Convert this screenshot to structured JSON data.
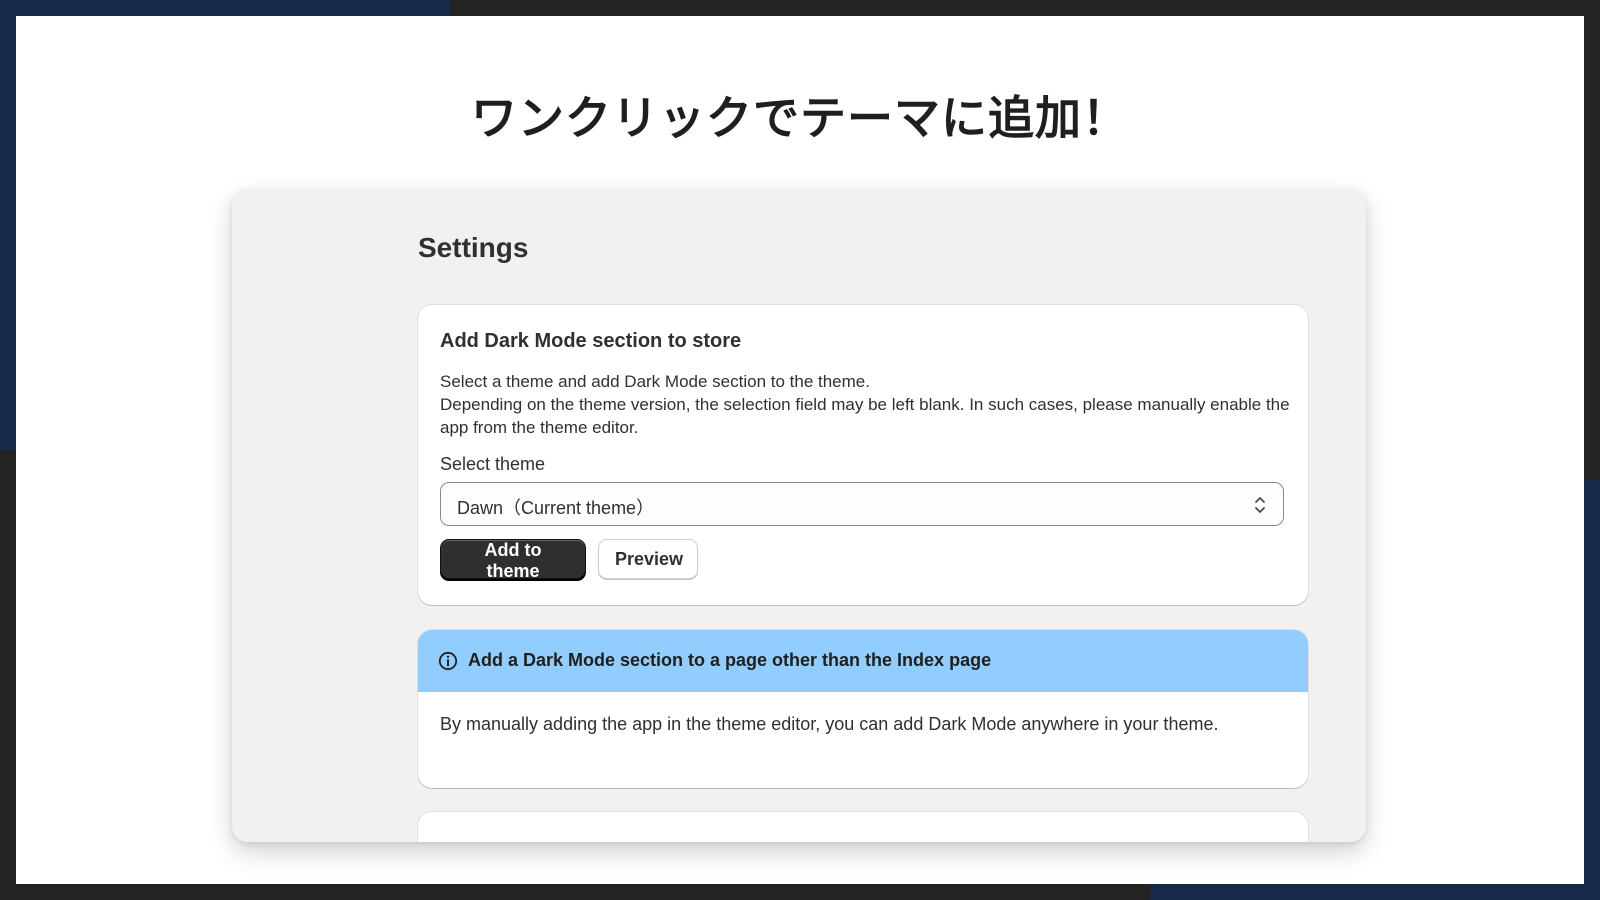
{
  "slide": {
    "headline": "ワンクリックでテーマに追加！"
  },
  "settings": {
    "title": "Settings",
    "add_card": {
      "title": "Add Dark Mode section to store",
      "description_line1": "Select a theme and add Dark Mode section to the theme.",
      "description_line2": "Depending on the theme version, the selection field may be left blank. In such cases, please manually enable the app from the theme editor.",
      "select_label": "Select theme",
      "select_value": "Dawn（Current theme）",
      "add_button": "Add to theme",
      "preview_button": "Preview"
    },
    "info_card": {
      "icon": "info-icon",
      "banner_title": "Add a Dark Mode section to a page other than the Index page",
      "body": "By manually adding the app in the theme editor, you can add Dark Mode anywhere in your theme."
    }
  },
  "colors": {
    "background_dark": "#232323",
    "accent_navy": "#18294a",
    "panel_bg": "#f1f1f1",
    "banner_blue": "#91ceff",
    "primary_button": "#2f2f2f",
    "text": "#303030"
  }
}
